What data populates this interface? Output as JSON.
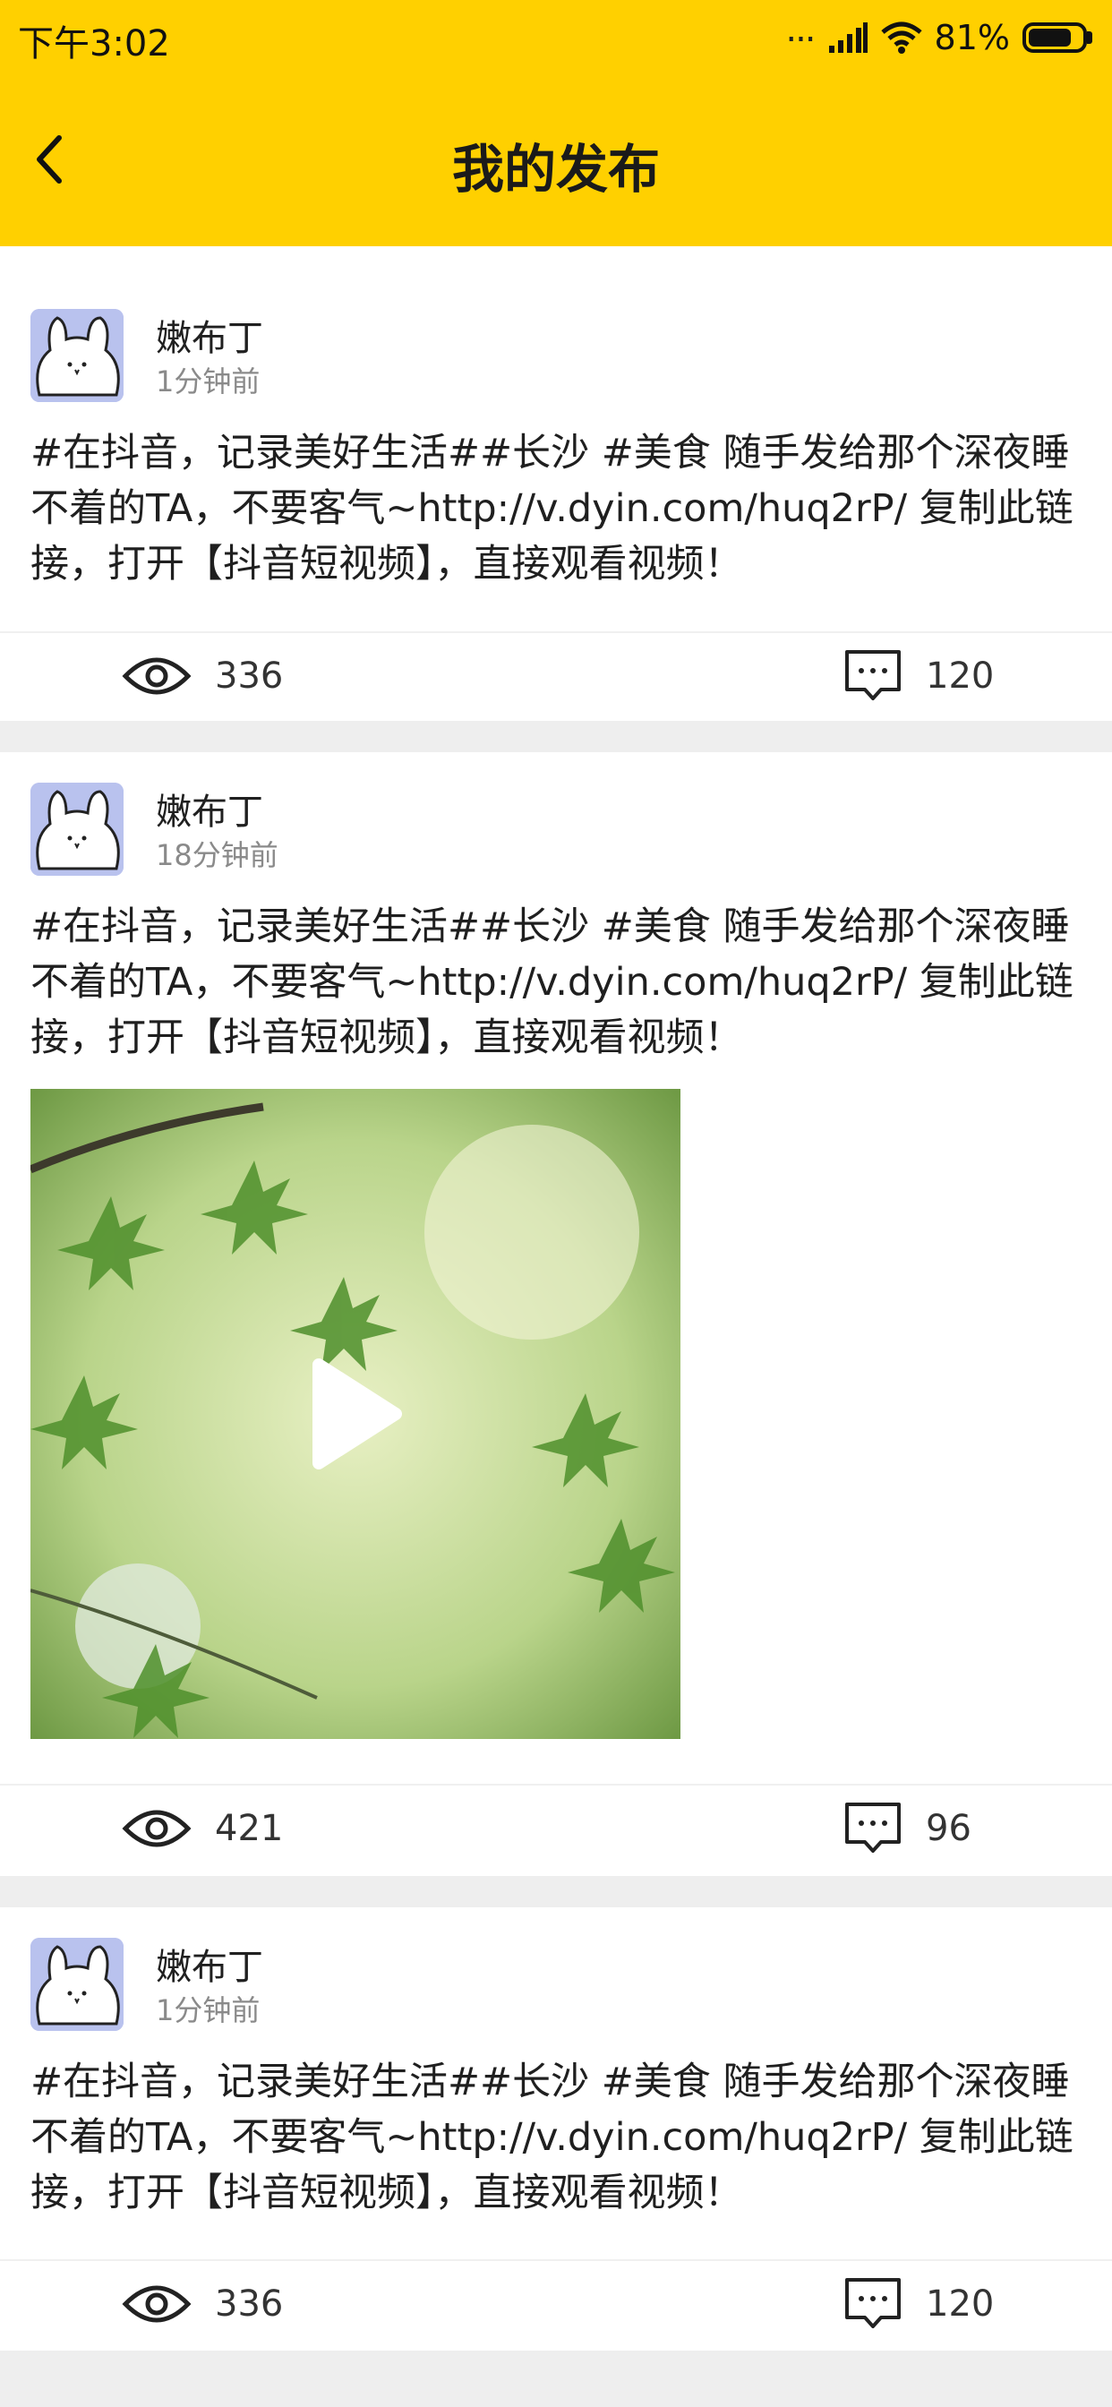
{
  "status_bar": {
    "time": "下午3:02",
    "signal_dots": "...",
    "battery_percent": "81%",
    "battery_level": 0.81
  },
  "nav": {
    "title": "我的发布",
    "back_icon": "chevron-left-icon"
  },
  "colors": {
    "header_bg": "#ffd000",
    "page_bg": "#eeeeee",
    "card_bg": "#ffffff"
  },
  "posts": [
    {
      "username": "嫩布丁",
      "time": "1分钟前",
      "text": "#在抖音，记录美好生活##长沙 #美食 随手发给那个深夜睡不着的TA，不要客气~http://v.dyin.com/huq2rP/ 复制此链接，打开【抖音短视频】，直接观看视频！",
      "views": "336",
      "comments": "120"
    },
    {
      "username": "嫩布丁",
      "time": "18分钟前",
      "text": "#在抖音，记录美好生活##长沙 #美食 随手发给那个深夜睡不着的TA，不要客气~http://v.dyin.com/huq2rP/ 复制此链接，打开【抖音短视频】，直接观看视频！",
      "has_video": true,
      "views": "421",
      "comments": "96"
    },
    {
      "username": "嫩布丁",
      "time": "1分钟前",
      "text": "#在抖音，记录美好生活##长沙 #美食 随手发给那个深夜睡不着的TA，不要客气~http://v.dyin.com/huq2rP/ 复制此链接，打开【抖音短视频】，直接观看视频！",
      "views": "336",
      "comments": "120"
    }
  ],
  "icons": {
    "views": "eye-icon",
    "comments": "comment-icon",
    "play": "play-icon",
    "avatar": "bunny-avatar-icon"
  }
}
